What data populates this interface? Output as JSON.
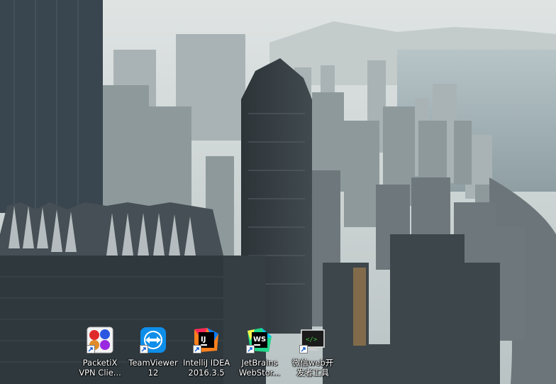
{
  "desktop": {
    "icons": [
      {
        "id": "packetix",
        "label_line1": "PacketiX",
        "label_line2": "VPN Clie...",
        "icon": "packetix-vpn-icon"
      },
      {
        "id": "teamviewer",
        "label_line1": "TeamViewer",
        "label_line2": "12",
        "icon": "teamviewer-icon"
      },
      {
        "id": "intellij",
        "label_line1": "IntelliJ IDEA",
        "label_line2": "2016.3.5",
        "icon": "intellij-idea-icon"
      },
      {
        "id": "webstorm",
        "label_line1": "JetBrains",
        "label_line2": "WebStor...",
        "icon": "webstorm-icon"
      },
      {
        "id": "wechat-devtools",
        "label_line1": "微信web开",
        "label_line2": "发者工具",
        "icon": "wechat-devtools-icon"
      }
    ],
    "colors": {
      "teamviewer_blue": "#0e8ee9",
      "intellij_bg": "#000000",
      "webstorm_accent": "#21d789",
      "devtools_green": "#3cbf3c"
    }
  }
}
